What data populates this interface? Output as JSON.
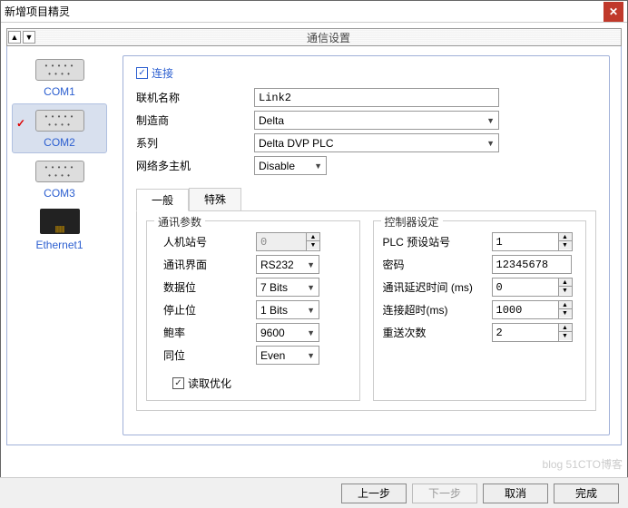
{
  "window": {
    "title": "新增项目精灵"
  },
  "toolbar": {
    "title": "通信设置"
  },
  "sidebar": {
    "com1": "COM1",
    "com2": "COM2",
    "com3": "COM3",
    "eth1": "Ethernet1"
  },
  "main": {
    "connect_label": "连接",
    "linkname_label": "联机名称",
    "linkname_value": "Link2",
    "vendor_label": "制造商",
    "vendor_value": "Delta",
    "series_label": "系列",
    "series_value": "Delta DVP PLC",
    "multi_label": "网络多主机",
    "multi_value": "Disable"
  },
  "tabs": {
    "general": "一般",
    "special": "特殊"
  },
  "comm": {
    "legend": "通讯参数",
    "station_label": "人机站号",
    "station_value": "0",
    "iface_label": "通讯界面",
    "iface_value": "RS232",
    "databits_label": "数据位",
    "databits_value": "7 Bits",
    "stopbits_label": "停止位",
    "stopbits_value": "1 Bits",
    "baud_label": "鲍率",
    "baud_value": "9600",
    "parity_label": "同位",
    "parity_value": "Even",
    "readopt_label": "读取优化"
  },
  "ctrl": {
    "legend": "控制器设定",
    "plc_label": "PLC 预设站号",
    "plc_value": "1",
    "pwd_label": "密码",
    "pwd_value": "12345678",
    "delay_label": "通讯延迟时间 (ms)",
    "delay_value": "0",
    "timeout_label": "连接超时(ms)",
    "timeout_value": "1000",
    "retry_label": "重送次数",
    "retry_value": "2"
  },
  "footer": {
    "prev": "上一步",
    "next": "下一步",
    "cancel": "取消",
    "finish": "完成"
  },
  "watermark": "blog 51CTO博客"
}
